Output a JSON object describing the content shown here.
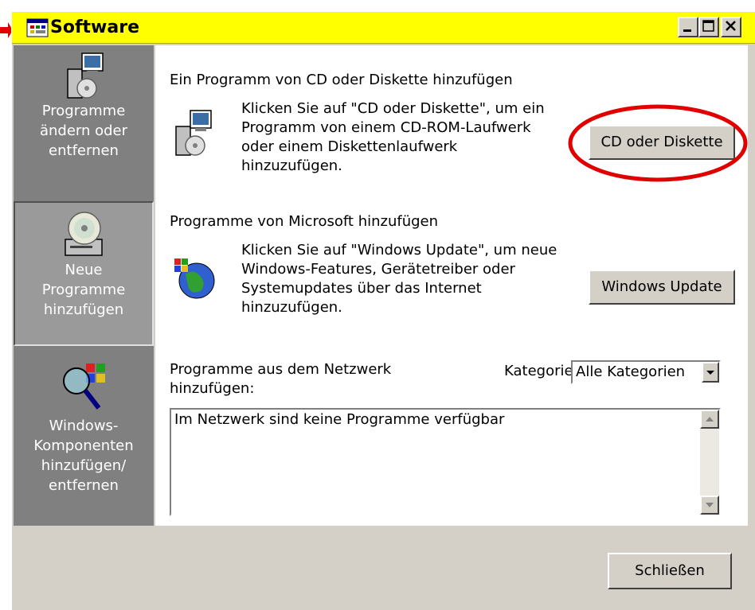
{
  "window": {
    "title": "Software",
    "controls": {
      "minimize": "minimize",
      "maximize": "maximize",
      "close": "close"
    }
  },
  "sidebar": {
    "items": [
      {
        "label": "Programme\nändern oder\nentfernen",
        "icon": "install-package-icon",
        "selected": false
      },
      {
        "label": "Neue\nProgramme\nhinzufügen",
        "icon": "cd-drive-icon",
        "selected": true
      },
      {
        "label": "Windows-\nKomponenten\nhinzufügen/\nentfernen",
        "icon": "windows-components-icon",
        "selected": false
      }
    ]
  },
  "sections": {
    "cd": {
      "heading": "Ein Programm von CD oder Diskette hinzufügen",
      "description": "Klicken Sie auf \"CD oder Diskette\", um ein\nProgramm von einem CD-ROM-Laufwerk\noder einem Diskettenlaufwerk\nhinzuzufügen.",
      "button_label": "CD oder Diskette"
    },
    "update": {
      "heading": "Programme von Microsoft hinzufügen",
      "description": "Klicken Sie auf \"Windows Update\", um neue\nWindows-Features, Gerätetreiber oder\nSystemupdates über das Internet\nhinzuzufügen.",
      "button_label": "Windows Update"
    },
    "network": {
      "heading": "Programme aus dem Netzwerk\nhinzufügen:",
      "category_label": "Kategorie:",
      "category_value": "Alle Kategorien",
      "list_empty_text": "Im Netzwerk sind keine Programme verfügbar"
    }
  },
  "footer": {
    "close_label": "Schließen"
  },
  "colors": {
    "titlebar": "#ffff00",
    "sidebar": "#808080",
    "highlight_ring": "#e00000",
    "face": "#d4d0c8"
  }
}
